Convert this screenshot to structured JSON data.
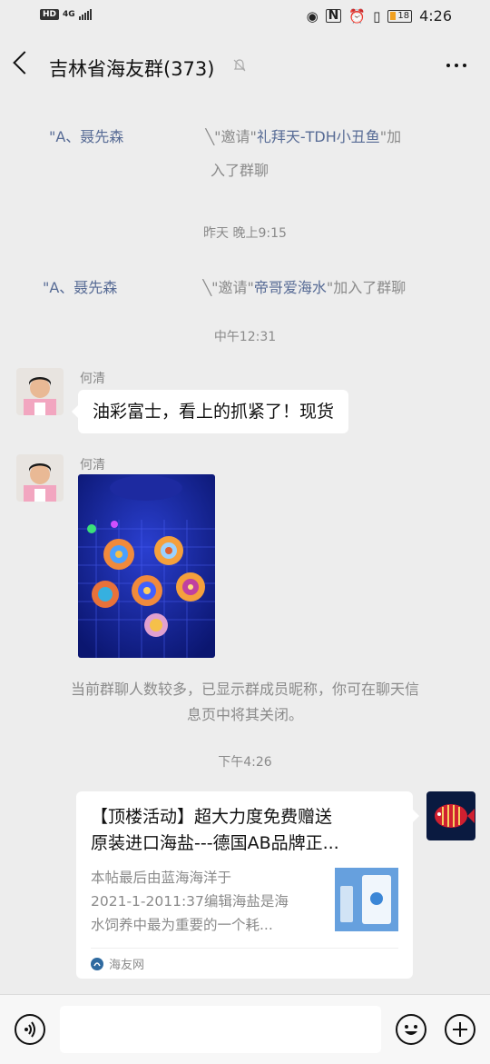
{
  "status_bar": {
    "hd": "HD",
    "network": "4G",
    "battery": "18",
    "time": "4:26"
  },
  "nav": {
    "title": "吉林省海友群(373)"
  },
  "notices": [
    {
      "inviter": "\"A、聂先森",
      "pre": "\"邀请\"",
      "invitee": "礼拜天-TDH小丑鱼",
      "post_line1": "\"加",
      "post_line2": "入了群聊"
    },
    {
      "inviter": "\"A、聂先森",
      "pre": "\"邀请\"",
      "invitee": "帝哥爱海水",
      "post": "\"加入了群聊"
    }
  ],
  "times": {
    "t1": "昨天 晚上9:15",
    "t2": "中午12:31",
    "t3": "下午4:26"
  },
  "messages": {
    "msg1": {
      "sender": "何清",
      "text": "油彩富士，看上的抓紧了！现货"
    },
    "msg2": {
      "sender": "何清"
    }
  },
  "tip": {
    "line1": "当前群聊人数较多，已显示群成员昵称，你可在聊天信",
    "line2": "息页中将其关闭。"
  },
  "card": {
    "title_line1": "【顶楼活动】超大力度免费赠送",
    "title_line2": "原装进口海盐---德国AB品牌正...",
    "desc_line1": "本帖最后由蓝海海洋于",
    "desc_line2": "2021-1-2011:37编辑海盐是海",
    "desc_line3": "水饲养中最为重要的一个耗...",
    "source": "海友网"
  },
  "icons": [
    "back-icon",
    "mute-bell-icon",
    "more-icon",
    "voice-icon",
    "emoji-icon",
    "plus-icon"
  ]
}
